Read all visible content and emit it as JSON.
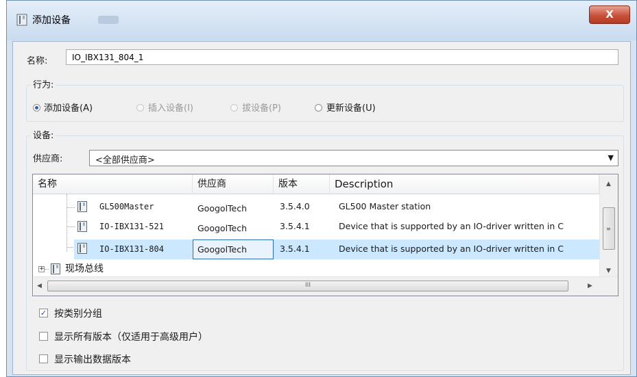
{
  "window": {
    "title": "添加设备",
    "close_glyph": "X"
  },
  "name": {
    "label": "名称:",
    "value": "IO_IBX131_804_1"
  },
  "behavior": {
    "legend": "行为:",
    "options": [
      {
        "label": "添加设备(A)",
        "selected": true,
        "enabled": true
      },
      {
        "label": "插入设备(I)",
        "selected": false,
        "enabled": false
      },
      {
        "label": "拔设备(P)",
        "selected": false,
        "enabled": false
      },
      {
        "label": "更新设备(U)",
        "selected": false,
        "enabled": true
      }
    ]
  },
  "devices": {
    "legend": "设备:",
    "vendor_label": "供应商:",
    "vendor_value": "<全部供应商>",
    "columns": [
      "名称",
      "供应商",
      "版本",
      "Description"
    ],
    "rows": [
      {
        "name": "GL500Master",
        "vendor": "GoogolTech",
        "version": "3.5.4.0",
        "description": "GL500 Master station",
        "selected": false
      },
      {
        "name": "IO-IBX131-521",
        "vendor": "GoogolTech",
        "version": "3.5.4.1",
        "description": "Device that is supported by an IO-driver written in C",
        "selected": false
      },
      {
        "name": "IO-IBX131-804",
        "vendor": "GoogolTech",
        "version": "3.5.4.1",
        "description": "Device that is supported by an IO-driver written in C",
        "selected": true
      }
    ],
    "group_node": {
      "name": "现场总线",
      "expander": "+"
    },
    "scroll_grip": "III"
  },
  "options": [
    {
      "label": "按类别分组",
      "checked": true
    },
    {
      "label": "显示所有版本（仅适用于高级用户）",
      "checked": false
    },
    {
      "label": "显示输出数据版本",
      "checked": false
    }
  ],
  "icons": {
    "device": "device-module-icon",
    "radio": "radio-dot",
    "check": "check-mark"
  },
  "colors": {
    "selection": "#cce8ff",
    "selection_border": "#2a6fb3",
    "close_button": "#c8513a",
    "titlebar": "#c9dbef"
  }
}
